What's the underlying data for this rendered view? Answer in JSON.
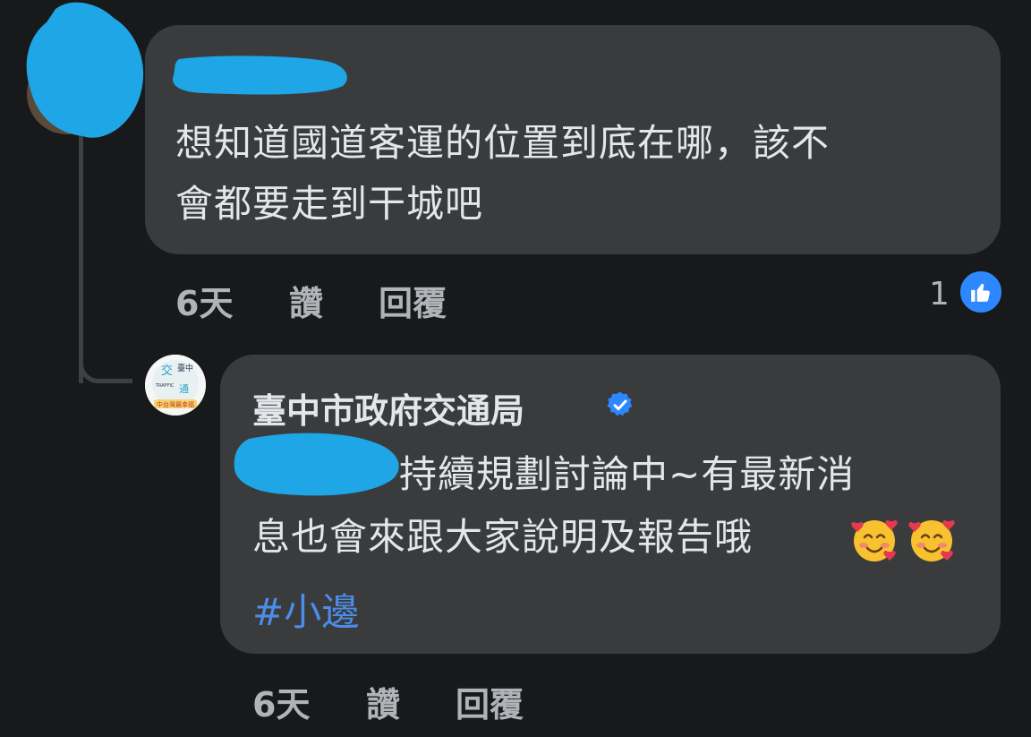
{
  "comment1": {
    "text_line1": "想知道國道客運的位置到底在哪，該不",
    "text_line2": "會都要走到干城吧",
    "time": "6天",
    "like_action": "讚",
    "reply_action": "回覆",
    "like_count": "1"
  },
  "comment2": {
    "author": "臺中市政府交通局",
    "text_line1": "持續規劃討論中~有最新消",
    "text_line2": "息也會來跟大家說明及報告哦",
    "hashtag": "#小邊",
    "time": "6天",
    "like_action": "讚",
    "reply_action": "回覆",
    "emoji": [
      "smiling-face-with-hearts",
      "smiling-face-with-hearts"
    ]
  },
  "avatar2_text": {
    "line1": "交",
    "line2": "臺中",
    "line3": "TRAFFIC",
    "line4": "通",
    "line5": "中台灣最幸福"
  },
  "colors": {
    "background": "#18191a",
    "bubble": "#3a3b3c",
    "text": "#e4e6eb",
    "secondary_text": "#b0b3b8",
    "link": "#4d8de8",
    "like_blue": "#2d88ff",
    "redaction": "#1ea6e6"
  }
}
